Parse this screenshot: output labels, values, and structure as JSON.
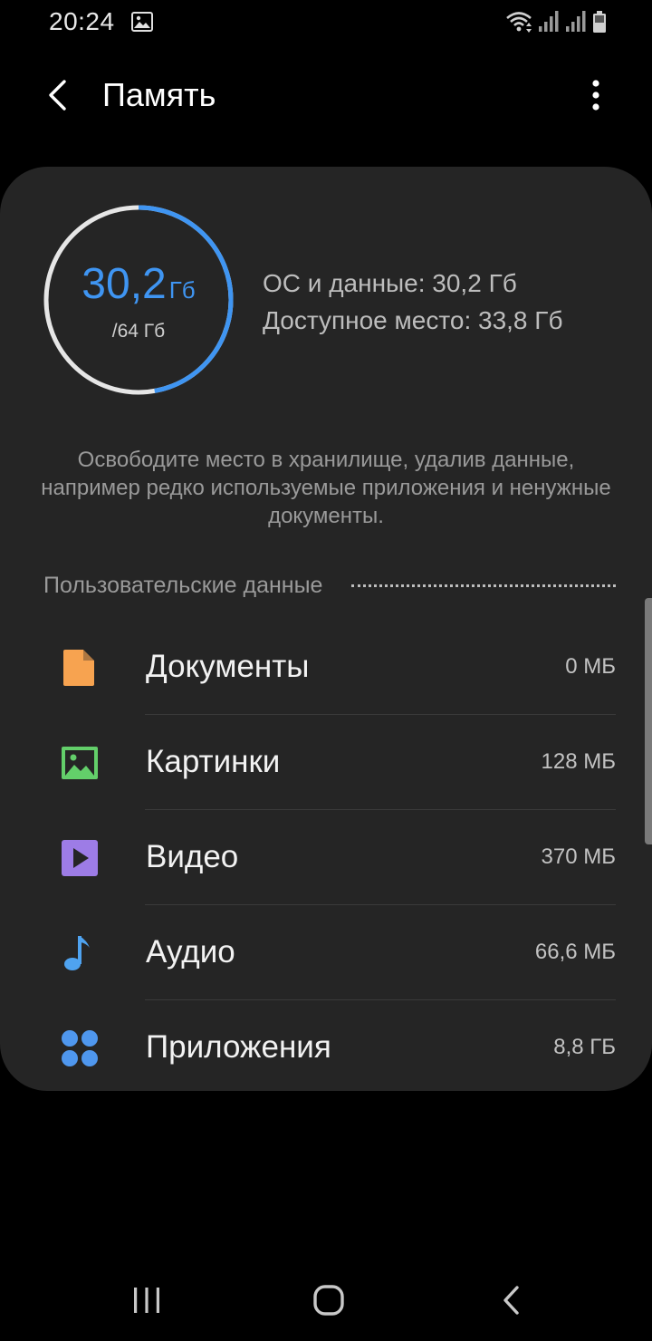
{
  "status_bar": {
    "time": "20:24",
    "icons": [
      "gallery-icon",
      "wifi-icon",
      "signal-icon",
      "signal-icon",
      "battery-icon"
    ]
  },
  "header": {
    "title": "Память",
    "back_icon": "back-arrow-icon",
    "menu_icon": "more-vertical-icon"
  },
  "storage": {
    "used_value": "30,2",
    "used_unit": "Гб",
    "total": "/64 Гб",
    "used_fraction": 0.472,
    "os_data": "ОС и данные: 30,2 Гб",
    "available": "Доступное место: 33,8 Гб",
    "accent_color": "#3f95f2",
    "track_color": "#e6e6e6"
  },
  "hint": "Освободите место в хранилище, удалив данные, например редко используемые приложения и ненужные документы.",
  "section": {
    "title": "Пользовательские данные"
  },
  "items": [
    {
      "label": "Документы",
      "size": "0 МБ",
      "icon": "document-icon",
      "color": "#f7a350"
    },
    {
      "label": "Картинки",
      "size": "128 МБ",
      "icon": "image-icon",
      "color": "#63cf6a"
    },
    {
      "label": "Видео",
      "size": "370 МБ",
      "icon": "video-icon",
      "color": "#9d7ce6"
    },
    {
      "label": "Аудио",
      "size": "66,6 МБ",
      "icon": "music-note-icon",
      "color": "#4fa3f0"
    },
    {
      "label": "Приложения",
      "size": "8,8 ГБ",
      "icon": "apps-grid-icon",
      "color": "#4f97ee"
    }
  ],
  "nav_bar": {
    "icons": [
      "recents-icon",
      "home-icon",
      "back-icon"
    ]
  }
}
